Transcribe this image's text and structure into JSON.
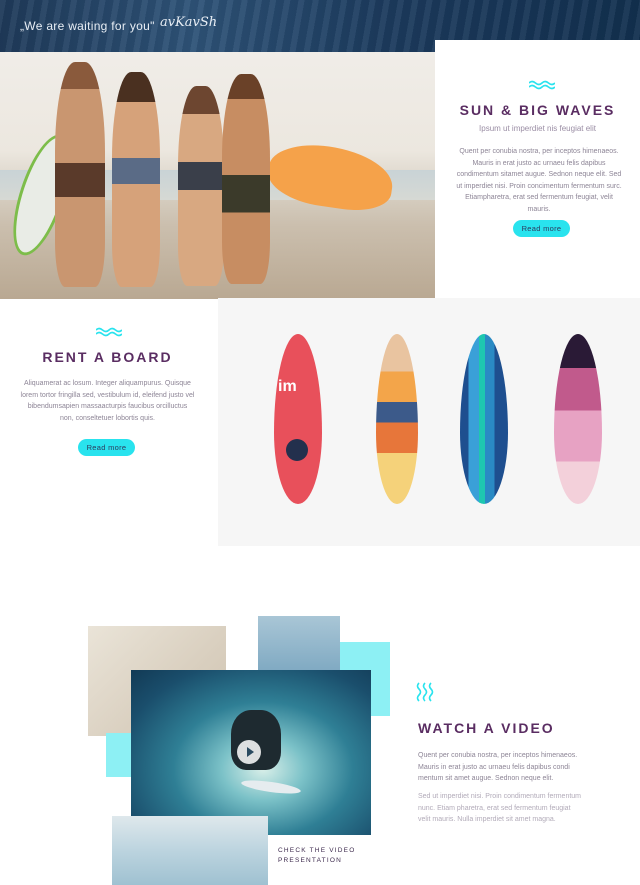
{
  "header": {
    "tagline": "„We are waiting for you\"",
    "signature": "avKavSh"
  },
  "hero": {
    "title": "SUN & BIG WAVES",
    "subtitle": "Ipsum ut imperdiet nis feugiat elit",
    "body": "Quent per conubia nostra, per inceptos himenaeos. Mauris in erat justo ac urnaeu felis dapibus condimentum sitamet augue. Sednon neque elit. Sed ut imperdiet nisi. Proin concimentum fermentum surc. Etiampharetra, erat sed fermentum feugiat, velit mauris.",
    "button": "Read more"
  },
  "rent": {
    "title": "RENT A BOARD",
    "body": "Aliquamerat ac losum. Integer aliquampurus. Quisque lorem tortor fringilla sed, vestibulum id, eleifend justo vel bibendumsapien massaacturpis faucibus orcilluctus non, conseltetuer lobortis quis.",
    "button": "Read more"
  },
  "video": {
    "title": "WATCH A VIDEO",
    "body1": "Quent per conubia nostra, per inceptos himenaeos. Mauris in erat justo ac urnaeu felis dapibus condi mentum sit amet augue. Sednon neque elit.",
    "body2": "Sed ut imperdiet nisi. Proin condimentum fermentum nunc. Etiam pharetra, erat sed fermentum feugiat velit mauris. Nulla imperdiet sit amet magna.",
    "caption": "CHECK THE VIDEO PRESENTATION"
  },
  "colors": {
    "accent": "#29e3ee",
    "heading": "#5a2d62"
  }
}
